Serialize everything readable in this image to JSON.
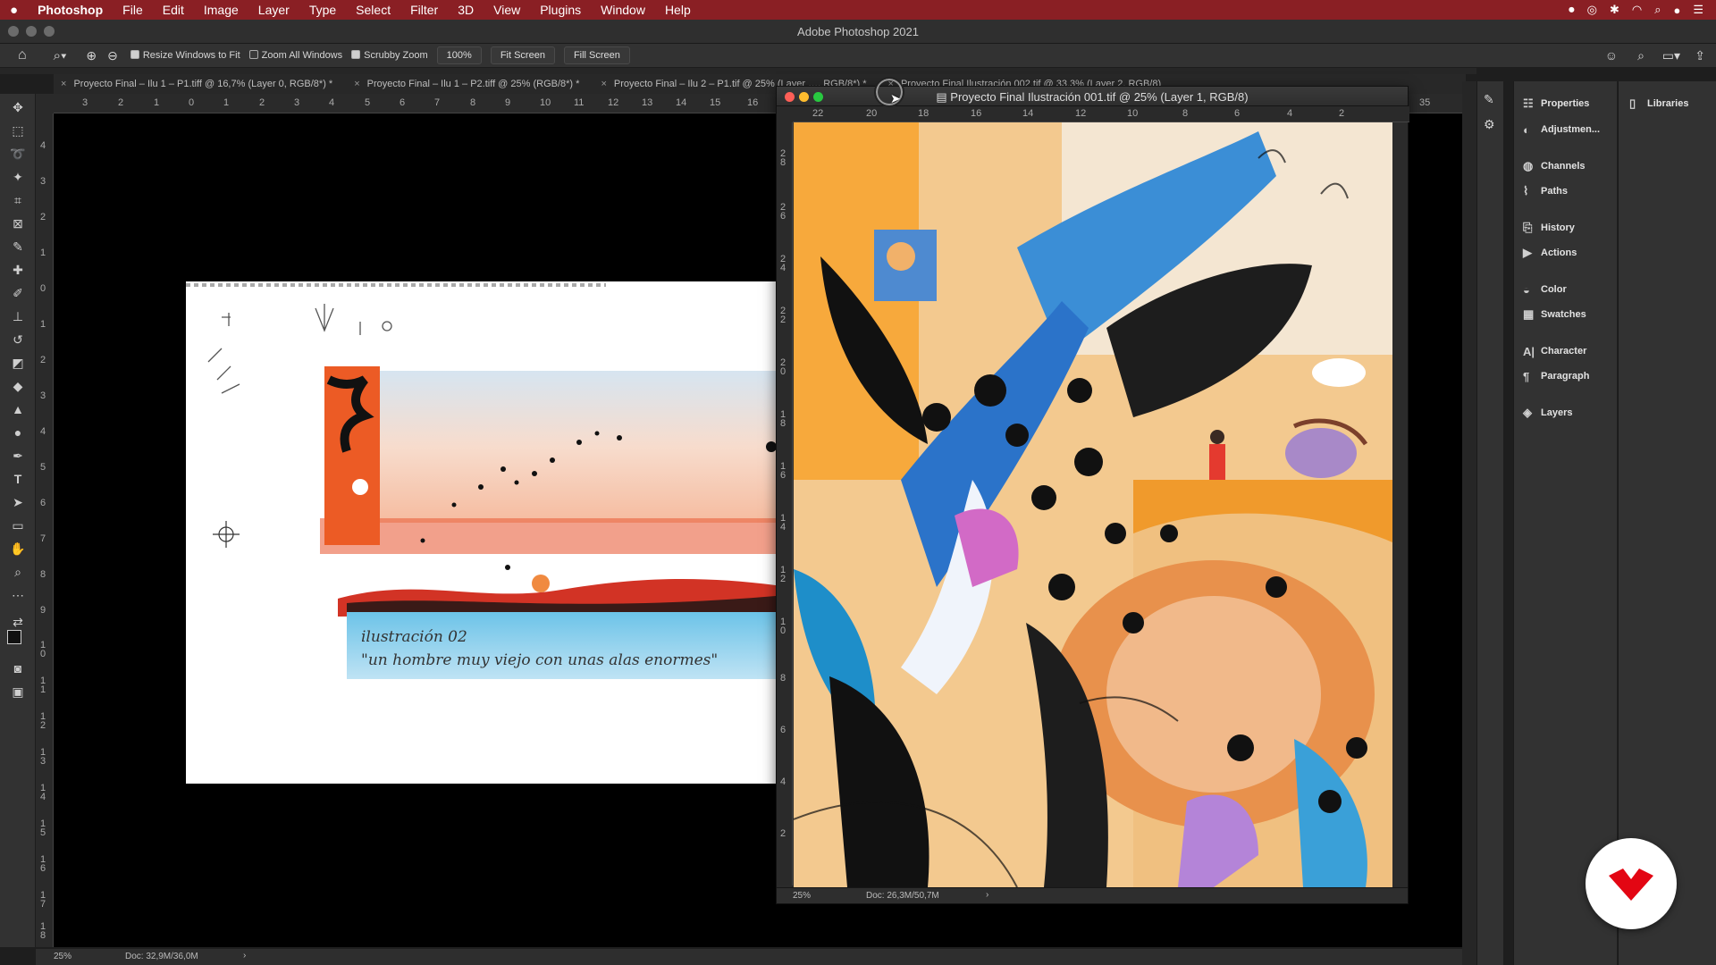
{
  "menubar": {
    "apple": "",
    "app_name": "Photoshop",
    "items": [
      "File",
      "Edit",
      "Image",
      "Layer",
      "Type",
      "Select",
      "Filter",
      "3D",
      "View",
      "Plugins",
      "Window",
      "Help"
    ]
  },
  "window": {
    "title": "Adobe Photoshop 2021"
  },
  "options": {
    "resize_windows": "Resize Windows to Fit",
    "zoom_all": "Zoom All Windows",
    "scrubby_zoom": "Scrubby Zoom",
    "zoom_value": "100%",
    "fit_screen": "Fit Screen",
    "fill_screen": "Fill Screen"
  },
  "tabs": [
    "Proyecto Final – Ilu 1 – P1.tiff @ 16,7% (Layer 0, RGB/8*) *",
    "Proyecto Final – Ilu 1 – P2.tiff @ 25% (RGB/8*) *",
    "Proyecto Final – Ilu 2 – P1.tif @ 25% (Layer …, RGB/8*) *",
    "Proyecto Final Ilustración 002.tif @ 33,3% (Layer 2, RGB/8)"
  ],
  "ruler_top": [
    "3",
    "2",
    "1",
    "0",
    "1",
    "2",
    "3",
    "4",
    "5",
    "6",
    "7",
    "8",
    "9",
    "10",
    "11",
    "12",
    "13",
    "14",
    "15",
    "16",
    "35"
  ],
  "ruler_left": [
    "4",
    "3",
    "2",
    "1",
    "0",
    "1",
    "2",
    "3",
    "4",
    "5",
    "6",
    "7",
    "8",
    "9",
    "1 0",
    "1 1",
    "1 2",
    "1 3",
    "1 4",
    "1 5",
    "1 6",
    "1 7",
    "1 8"
  ],
  "floating_window": {
    "title": "Proyecto Final Ilustración 001.tif @ 25% (Layer 1, RGB/8)",
    "ruler_top": [
      "22",
      "20",
      "18",
      "16",
      "14",
      "12",
      "10",
      "8",
      "6",
      "4",
      "2"
    ],
    "ruler_left": [
      "2 8",
      "2 6",
      "2 4",
      "2 2",
      "2 0",
      "1 8",
      "1 6",
      "1 4",
      "1 2",
      "1 0",
      "8",
      "6",
      "4",
      "2"
    ],
    "zoom": "25%",
    "doc": "Doc: 26,3M/50,7M"
  },
  "sketch": {
    "caption_line1": "ilustración 02",
    "caption_line2": "\"un hombre muy viejo con unas alas enormes\""
  },
  "status": {
    "zoom": "25%",
    "doc": "Doc: 32,9M/36,0M"
  },
  "panels": [
    {
      "label": "Properties",
      "icon": "properties-icon"
    },
    {
      "label": "Adjustmen...",
      "icon": "adjustments-icon"
    },
    {
      "label": "Channels",
      "icon": "channels-icon"
    },
    {
      "label": "Paths",
      "icon": "paths-icon"
    },
    {
      "label": "History",
      "icon": "history-icon"
    },
    {
      "label": "Actions",
      "icon": "actions-icon"
    },
    {
      "label": "Color",
      "icon": "color-icon"
    },
    {
      "label": "Swatches",
      "icon": "swatches-icon"
    },
    {
      "label": "Character",
      "icon": "character-icon"
    },
    {
      "label": "Paragraph",
      "icon": "paragraph-icon"
    },
    {
      "label": "Layers",
      "icon": "layers-icon"
    }
  ],
  "libraries": {
    "label": "Libraries"
  },
  "colors": {
    "menubar": "#8a1f24",
    "accent": "#e30613"
  }
}
